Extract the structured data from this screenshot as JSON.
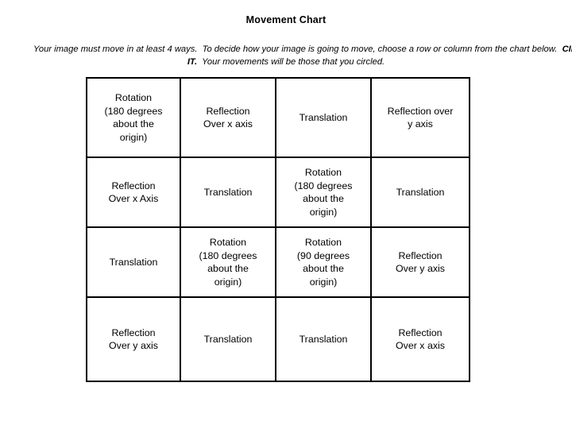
{
  "document": {
    "title": "Movement Chart",
    "instructions": {
      "part1": "Your image must move in at least 4 ways.  To decide how your image is going to move, choose a row or column from the chart below.  ",
      "emphasis": "CIRCLE IT.",
      "part2": "  Your movements will be those that you circled."
    }
  },
  "colors": {
    "page_background": "#ffffff",
    "text": "#000000",
    "table_border": "#000000"
  },
  "chart_data": {
    "type": "table",
    "title": "Movement Chart",
    "rows": 4,
    "columns": 4,
    "cells": [
      [
        "Rotation\n(180 degrees\nabout the\norigin)",
        "Reflection\nOver x axis",
        "Translation",
        "Reflection over\ny axis"
      ],
      [
        "Reflection\nOver x Axis",
        "Translation",
        "Rotation\n(180 degrees\nabout the\norigin)",
        "Translation"
      ],
      [
        "Translation",
        "Rotation\n(180 degrees\nabout the\norigin)",
        "Rotation\n(90 degrees\nabout the\norigin)",
        "Reflection\nOver y axis"
      ],
      [
        "Reflection\nOver y axis",
        "Translation",
        "Translation",
        "Reflection\nOver x axis"
      ]
    ]
  }
}
